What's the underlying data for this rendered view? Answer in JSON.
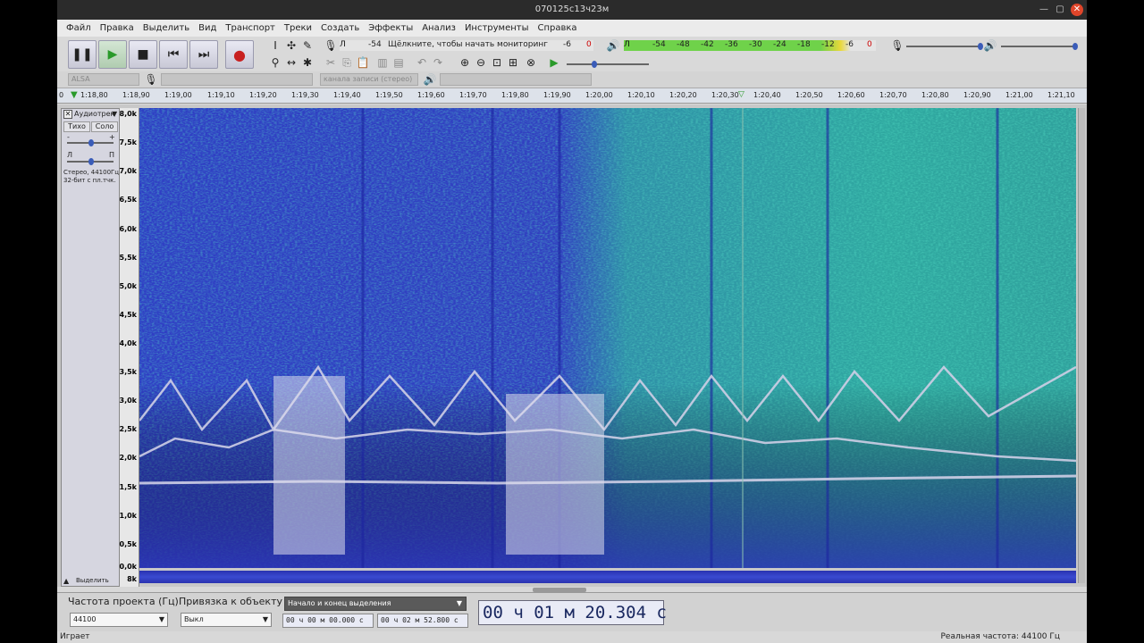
{
  "window": {
    "title": "070125с13ч23м"
  },
  "menu": [
    "Файл",
    "Правка",
    "Выделить",
    "Вид",
    "Транспорт",
    "Треки",
    "Создать",
    "Эффекты",
    "Анализ",
    "Инструменты",
    "Справка"
  ],
  "meters": {
    "rec_scale": [
      "-54",
      "-6",
      "0"
    ],
    "monitor_hint": "Щёлкните, чтобы начать мониторинг",
    "play_scale": [
      "-54",
      "-48",
      "-42",
      "-36",
      "-30",
      "-24",
      "-18",
      "-12",
      "-6",
      "0"
    ]
  },
  "device": {
    "host": "ALSA",
    "channels": "канала записи (стерео)"
  },
  "ruler": {
    "marks": [
      "1:18,90",
      "1:19,00",
      "1:19,10",
      "1:19,20",
      "1:19,30",
      "1:19,40",
      "1:19,50",
      "1:19,60",
      "1:19,70",
      "1:19,80",
      "1:19,90",
      "1:20,00",
      "1:20,10",
      "1:20,20",
      "1:20,30",
      "1:20,40",
      "1:20,50",
      "1:20,60",
      "1:20,70",
      "1:20,80",
      "1:20,90",
      "1:21,00",
      "1:21,10"
    ],
    "first": "1:18,80",
    "lead": "0"
  },
  "track": {
    "name": "Аудиотрек",
    "mute": "Тихо",
    "solo": "Соло",
    "gain_minus": "-",
    "gain_plus": "+",
    "pan_left": "Л",
    "pan_right": "П",
    "info1": "Стерео, 44100Гц",
    "info2": "32-бит с пл.тчк.",
    "select": "Выделить",
    "freq_labels": [
      "8,0k",
      "7,5k",
      "7,0k",
      "6,5k",
      "6,0k",
      "5,5k",
      "5,0k",
      "4,5k",
      "4,0k",
      "3,5k",
      "3,0k",
      "2,5k",
      "2,0k",
      "1,5k",
      "1,0k",
      "0,5k",
      "0,0k"
    ],
    "freq_label_2": "8k"
  },
  "bottom": {
    "rate_label": "Частота проекта (Гц)",
    "rate_value": "44100",
    "snap_label": "Привязка к объекту",
    "snap_value": "Выкл",
    "sel_mode": "Начало и конец выделения",
    "sel_start": "00 ч 00 м 00.000 с",
    "sel_end": "00 ч 02 м 52.800 с",
    "time": "00 ч 01 м 20.304 с"
  },
  "status": {
    "left": "Играет",
    "right": "Реальная частота: 44100 Гц"
  },
  "colors": {
    "spectrogram_bg": "#3a44c8",
    "spectrogram_hot": "#2ec6a0",
    "trace": "#c8c8e0"
  }
}
